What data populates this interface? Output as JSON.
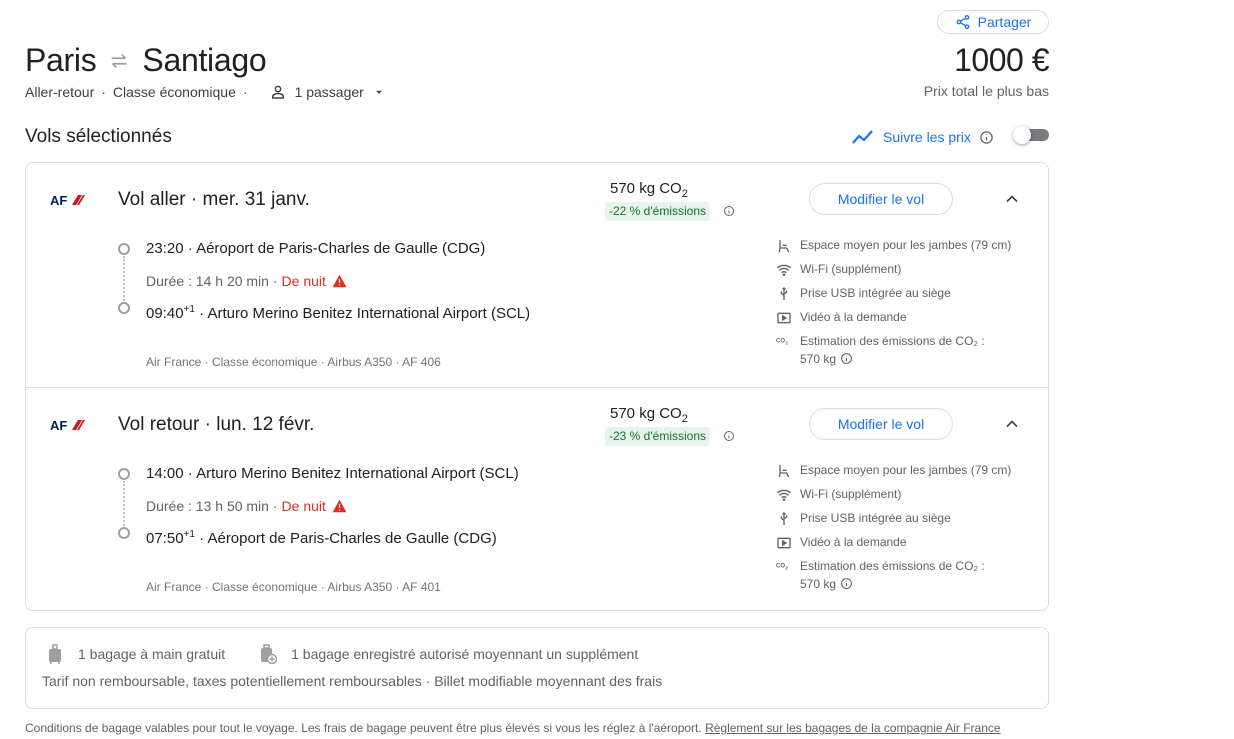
{
  "header": {
    "share_label": "Partager",
    "origin": "Paris",
    "destination": "Santiago",
    "trip_type": "Aller-retour",
    "cabin": "Classe économique",
    "passengers": "1 passager",
    "price": "1000 €",
    "price_label": "Prix total le plus bas"
  },
  "section": {
    "title": "Vols sélectionnés",
    "track_label": "Suivre les prix",
    "track_enabled": false
  },
  "legs": [
    {
      "airline_logo": "AF",
      "title": "Vol aller",
      "date": "mer. 31 janv.",
      "co2": "570 kg CO",
      "co2_sub": "2",
      "emissions_badge": "-22 % d'émissions",
      "modify_label": "Modifier le vol",
      "dep_time": "23:20",
      "dep_airport": "Aéroport de Paris-Charles de Gaulle (CDG)",
      "duration": "Durée : 14 h 20 min",
      "night": "De nuit",
      "arr_time": "09:40",
      "arr_offset": "+1",
      "arr_airport": "Arturo Merino Benitez International Airport (SCL)",
      "details": "Air France · Classe économique · Airbus A350 · AF 406",
      "amenities": {
        "legroom": "Espace moyen pour les jambes (79 cm)",
        "wifi": "Wi-Fi (supplément)",
        "usb": "Prise USB intégrée au siège",
        "video": "Vidéo à la demande",
        "co2_label": "Estimation des émissions de CO₂ :",
        "co2_value": "570 kg"
      }
    },
    {
      "airline_logo": "AF",
      "title": "Vol retour",
      "date": "lun. 12 févr.",
      "co2": "570 kg CO",
      "co2_sub": "2",
      "emissions_badge": "-23 % d'émissions",
      "modify_label": "Modifier le vol",
      "dep_time": "14:00",
      "dep_airport": "Arturo Merino Benitez International Airport (SCL)",
      "duration": "Durée : 13 h 50 min",
      "night": "De nuit",
      "arr_time": "07:50",
      "arr_offset": "+1",
      "arr_airport": "Aéroport de Paris-Charles de Gaulle (CDG)",
      "details": "Air France · Classe économique · Airbus A350 · AF 401",
      "amenities": {
        "legroom": "Espace moyen pour les jambes (79 cm)",
        "wifi": "Wi-Fi (supplément)",
        "usb": "Prise USB intégrée au siège",
        "video": "Vidéo à la demande",
        "co2_label": "Estimation des émissions de CO₂ :",
        "co2_value": "570 kg"
      }
    }
  ],
  "baggage": {
    "carry_on": "1 bagage à main gratuit",
    "checked": "1 bagage enregistré autorisé moyennant un supplément",
    "fare_conditions": "Tarif non remboursable, taxes potentiellement remboursables · Billet modifiable moyennant des frais"
  },
  "footer": {
    "text": "Conditions de bagage valables pour tout le voyage. Les frais de bagage peuvent être plus élevés si vous les réglez à l'aéroport. ",
    "link": "Règlement sur les bagages de la compagnie Air France"
  },
  "colors": {
    "accent": "#1a73e8",
    "night_warning": "#d93025",
    "emissions_bg": "#e6f4ea",
    "emissions_text": "#137333",
    "airline_logo_red": "#d0111b",
    "airline_logo_blue": "#002157"
  }
}
